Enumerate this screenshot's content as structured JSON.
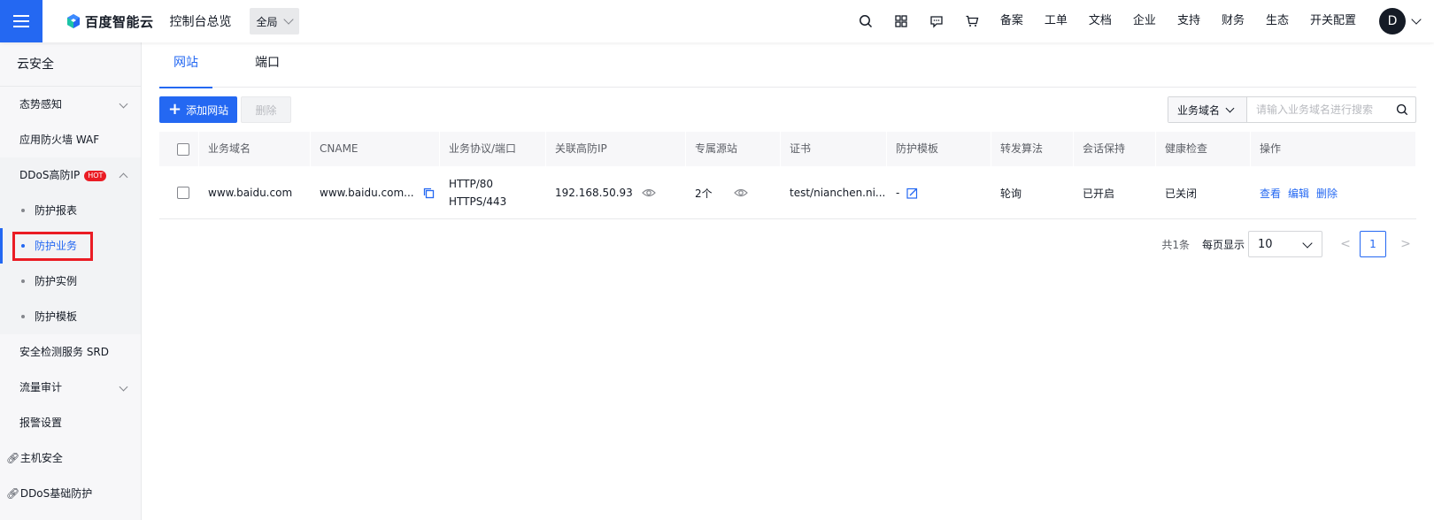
{
  "header": {
    "brand": "百度智能云",
    "console": "控制台总览",
    "region": "全局",
    "links": [
      "备案",
      "工单",
      "文档",
      "企业",
      "支持",
      "财务",
      "生态",
      "开关配置"
    ],
    "avatar": "D"
  },
  "sidebar": {
    "title": "云安全",
    "items": {
      "situation": "态势感知",
      "waf": "应用防火墙 WAF",
      "ddos": "DDoS高防IP",
      "hot": "HOT",
      "sub1": "防护报表",
      "sub2": "防护业务",
      "sub3": "防护实例",
      "sub4": "防护模板",
      "srd": "安全检测服务 SRD",
      "flow": "流量审计",
      "alarm": "报警设置",
      "host": "主机安全",
      "ddos_basic": "DDoS基础防护"
    }
  },
  "tabs": [
    "网站",
    "端口"
  ],
  "toolbar": {
    "add": "添加网站",
    "delete": "删除",
    "search_type": "业务域名",
    "search_placeholder": "请输入业务域名进行搜索"
  },
  "table": {
    "headers": [
      "业务域名",
      "CNAME",
      "业务协议/端口",
      "关联高防IP",
      "专属源站",
      "证书",
      "防护模板",
      "转发算法",
      "会话保持",
      "健康检查",
      "操作"
    ],
    "row": {
      "domain": "www.baidu.com",
      "cname": "www.baidu.com...",
      "protocol1": "HTTP/80",
      "protocol2": "HTTPS/443",
      "ip": "192.168.50.93",
      "origin": "2个",
      "cert": "test/nianchen.ni...",
      "template": "-",
      "algo": "轮询",
      "session": "已开启",
      "health": "已关闭",
      "op_view": "查看",
      "op_edit": "编辑",
      "op_delete": "删除"
    }
  },
  "pager": {
    "total": "共1条",
    "size_label": "每页显示",
    "size": "10",
    "prev": "<",
    "page": "1",
    "next": ">"
  },
  "colors": {
    "primary": "#2468f2",
    "highlight": "#ea1c24",
    "hot": "#ea1c24"
  }
}
